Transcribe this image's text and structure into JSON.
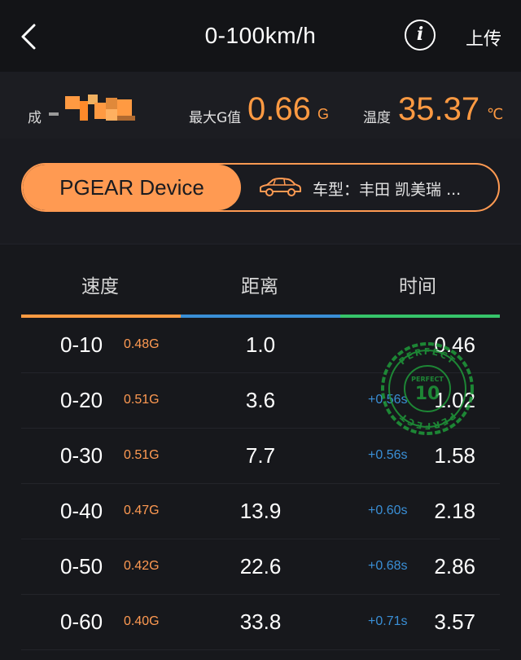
{
  "header": {
    "title": "0-100km/h",
    "upload_label": "上传"
  },
  "stats": {
    "score_label": "成",
    "maxg_label": "最大G值",
    "maxg_value": "0.66",
    "maxg_unit": "G",
    "temp_label": "温度",
    "temp_value": "35.37",
    "temp_unit": "℃"
  },
  "device": {
    "name": "PGEAR Device",
    "car_model": "车型：丰田 凯美瑞 ..."
  },
  "table": {
    "columns": [
      "速度",
      "距离",
      "时间"
    ],
    "tab_colors": [
      "#ff9a42",
      "#3a8fd6",
      "#36c46a"
    ],
    "rows": [
      {
        "range": "0-10",
        "g": "0.48G",
        "distance": "1.0",
        "delta": "",
        "time": "0.46"
      },
      {
        "range": "0-20",
        "g": "0.51G",
        "distance": "3.6",
        "delta": "+0.56s",
        "time": "1.02"
      },
      {
        "range": "0-30",
        "g": "0.51G",
        "distance": "7.7",
        "delta": "+0.56s",
        "time": "1.58"
      },
      {
        "range": "0-40",
        "g": "0.47G",
        "distance": "13.9",
        "delta": "+0.60s",
        "time": "2.18"
      },
      {
        "range": "0-50",
        "g": "0.42G",
        "distance": "22.6",
        "delta": "+0.68s",
        "time": "2.86"
      },
      {
        "range": "0-60",
        "g": "0.40G",
        "distance": "33.8",
        "delta": "+0.71s",
        "time": "3.57"
      }
    ]
  },
  "stamp": {
    "text": "PERFECT",
    "number": "10",
    "color": "#1f9a3a"
  },
  "colors": {
    "accent": "#ff9a52",
    "blue": "#3a8fd6",
    "green": "#36c46a"
  }
}
